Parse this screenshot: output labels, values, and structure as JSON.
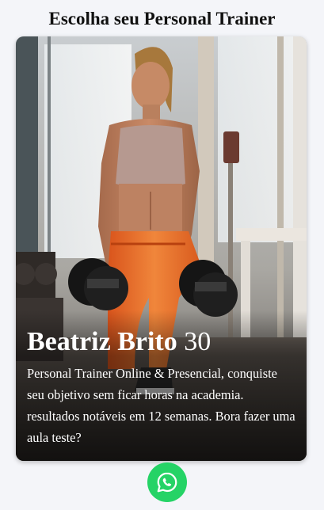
{
  "page": {
    "title": "Escolha seu Personal Trainer"
  },
  "trainer": {
    "name": "Beatriz Brito",
    "age": "30",
    "description": "Personal Trainer Online & Presencial, conquiste seu objetivo sem ficar horas na academia. resultados notáveis em 12 semanas. Bora fazer uma aula teste?"
  },
  "contact": {
    "icon": "whatsapp-icon",
    "color": "#25d366"
  }
}
